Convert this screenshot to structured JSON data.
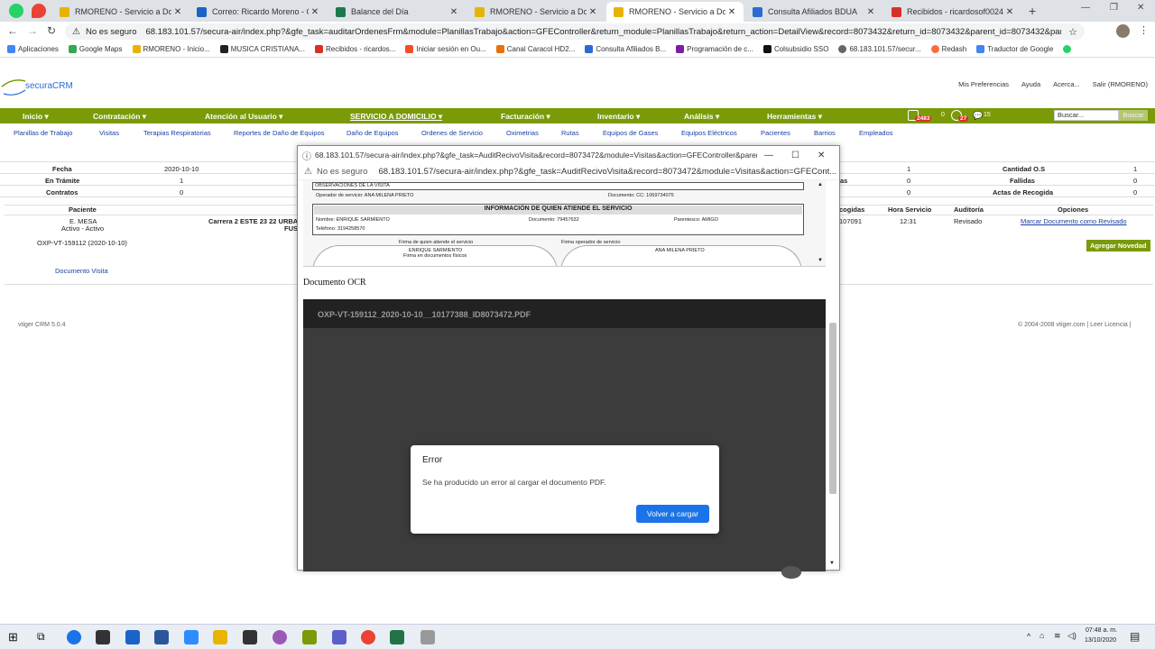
{
  "browser": {
    "tabs": [
      {
        "title": "RMORENO - Servicio a Domicil",
        "color": "#e6b400"
      },
      {
        "title": "Correo: Ricardo Moreno - Outl",
        "color": "#1a64c8"
      },
      {
        "title": "Balance del Día",
        "color": "#1a7a4a"
      },
      {
        "title": "RMORENO - Servicio a Domicil",
        "color": "#e6b400"
      },
      {
        "title": "RMORENO - Servicio a Domicil",
        "color": "#e6b400"
      },
      {
        "title": "Consulta Afiliados BDUA",
        "color": "#2a6bd4"
      },
      {
        "title": "Recibidos - ricardosof0024@gr",
        "color": "#d93025"
      }
    ],
    "security": "No es seguro",
    "url": "68.183.101.57/secura-air/index.php?&gfe_task=auditarOrdenesFrm&module=PlanillasTrabajo&action=GFEController&return_module=PlanillasTrabajo&return_action=DetailView&record=8073432&return_id=8073432&parent_id=8073432&parenttab=...",
    "bookmarks": [
      "Aplicaciones",
      "Google Maps",
      "RMORENO - Inicio...",
      "MUSICA CRISTIANA...",
      "Recibidos - ricardos...",
      "Iniciar sesión en Ou...",
      "Canal Caracol HD2...",
      "Consulta Afiliados B...",
      "Programación de c...",
      "Colsubsidio SSO",
      "68.183.101.57/secur...",
      "Redash",
      "Traductor de Google"
    ]
  },
  "crm": {
    "logo": "securaCRM",
    "toplinks": [
      "Mis Preferencias",
      "Ayuda",
      "Acerca...",
      "Salir (RMORENO)"
    ],
    "mainnav": [
      "Inicio ▾",
      "Contratación ▾",
      "Atención al Usuario ▾",
      "SERVICIO A DOMICILIO ▾",
      "Facturación ▾",
      "Inventario ▾",
      "Análisis ▾",
      "Herramientas ▾"
    ],
    "badges": {
      "a": "2483",
      "b": "0",
      "c": "27",
      "d": "15"
    },
    "search_placeholder": "Buscar...",
    "search_btn": "Buscar",
    "subnav": [
      "Planillas de Trabajo",
      "Visitas",
      "Terapias Respiratorias",
      "Reportes de Daño de Equipos",
      "Daño de Equipos",
      "Ordenes de Servicio",
      "Oximetrias",
      "Rutas",
      "Equipos de Gases",
      "Equipos Eléctricos",
      "Pacientes",
      "Barrios",
      "Empleados"
    ],
    "summary": {
      "fecha_label": "Fecha",
      "fecha": "2020-10-10",
      "tramite_label": "En Trámite",
      "tramite": "1",
      "contratos_label": "Contratos",
      "contratos": "0",
      "r1": "1",
      "cant_os_label": "Cantidad O.S",
      "cant_os": "1",
      "r2": "0",
      "fallidas_label": "Fallidas",
      "fallidas": "0",
      "r3": "0",
      "actas_label": "Actas de Recogida",
      "actas": "0",
      "partial": "as"
    },
    "headers": {
      "paciente": "Paciente",
      "recogidas": "cogidas",
      "hora": "Hora Servicio",
      "auditoria": "Auditoría",
      "opciones": "Opciones"
    },
    "row": {
      "name": "E. MESA",
      "status": "Activo - Activo",
      "address": "Carrera 2 ESTE 23 22 URBA",
      "address2": "FUS",
      "code": "OXP-VT-159112 (2020-10-10)",
      "doc_link": "Documento Visita",
      "rec": "107091",
      "hora": "12:31",
      "audit": "Revisado",
      "opt_link": "Marcar Documento como Revisado",
      "novedad": "Agregar Novedad"
    },
    "footer_left": "vtiger CRM 5.0.4",
    "footer_right": "© 2004-2008 vtiger.com | Leer Licencia |"
  },
  "popup": {
    "title": "68.183.101.57/secura-air/index.php?&gfe_task=AuditRecivoVisita&record=8073472&module=Visitas&action=GFEController&parenttab=...",
    "security": "No es seguro",
    "url": "68.183.101.57/secura-air/index.php?&gfe_task=AuditRecivoVisita&record=8073472&module=Visitas&action=GFECont...",
    "doc": {
      "obs": "OBSERVACIONES DE LA VISITA",
      "operador": "Operador de servicio: ANA MILENA PRIETO",
      "documento": "Documento: CC: 1069734075",
      "section": "INFORMACIÓN DE QUIEN ATIENDE EL SERVICIO",
      "nombre": "Nombre: ENRIQUE SARMIENTO",
      "doc2": "Documento: 79457632",
      "parentesco": "Parentesco: AMIGO",
      "telefono": "Teléfono: 3194258570",
      "firma1": "Firma de quien atiende el servicio",
      "firma2": "Firma operador de servicio",
      "signer1": "ENRIQUE SARMIENTO",
      "signer1b": "Firma en documentos físicos",
      "signer2": "ANA MILENA PRIETO"
    },
    "ocr_title": "Documento OCR",
    "pdf_name": "OXP-VT-159112_2020-10-10__10177388_ID8073472.PDF"
  },
  "error": {
    "title": "Error",
    "message": "Se ha producido un error al cargar el documento PDF.",
    "button": "Volver a cargar"
  },
  "taskbar": {
    "time": "07:48 a. m.",
    "date": "13/10/2020"
  }
}
